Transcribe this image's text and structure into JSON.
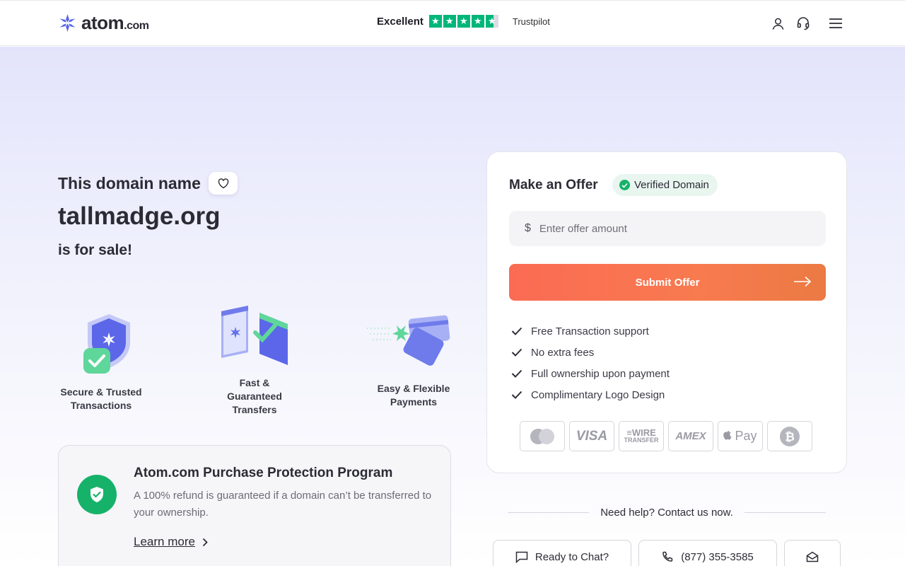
{
  "header": {
    "logo_text": "atom",
    "logo_suffix": ".com",
    "trust_label": "Excellent",
    "trust_brand": "Trustpilot",
    "trust_rating_stars": 4.5,
    "icons": [
      "user-icon",
      "headset-icon",
      "menu-icon"
    ]
  },
  "hero": {
    "line1": "This domain name",
    "domain": "tallmadge.org",
    "line3": "is for sale!"
  },
  "features": [
    {
      "label_line1": "Secure & Trusted",
      "label_line2": "Transactions"
    },
    {
      "label_line1": "Fast &",
      "label_line2": "Guaranteed",
      "label_line3": "Transfers"
    },
    {
      "label_line1": "Easy & Flexible",
      "label_line2": "Payments"
    }
  ],
  "protection": {
    "title": "Atom.com Purchase Protection Program",
    "text": "A 100% refund is guaranteed if a domain can’t be transferred to your ownership.",
    "link": "Learn more"
  },
  "offer": {
    "title": "Make an Offer",
    "badge": "Verified Domain",
    "currency": "$",
    "placeholder": "Enter offer amount",
    "value": "",
    "submit": "Submit Offer",
    "benefits": [
      "Free Transaction support",
      "No extra fees",
      "Full ownership upon payment",
      "Complimentary Logo Design"
    ],
    "payment_methods": [
      "Mastercard",
      "VISA",
      "WIRE TRANSFER",
      "AMEX",
      "Pay",
      "Bitcoin"
    ]
  },
  "help": {
    "text": "Need help? Contact us now.",
    "chat": "Ready to Chat?",
    "phone": "(877) 355-3585"
  },
  "colors": {
    "accent": "#fb6b54",
    "success": "#17b26a",
    "trustpilot": "#00b67a",
    "brand": "#4a56e2"
  }
}
